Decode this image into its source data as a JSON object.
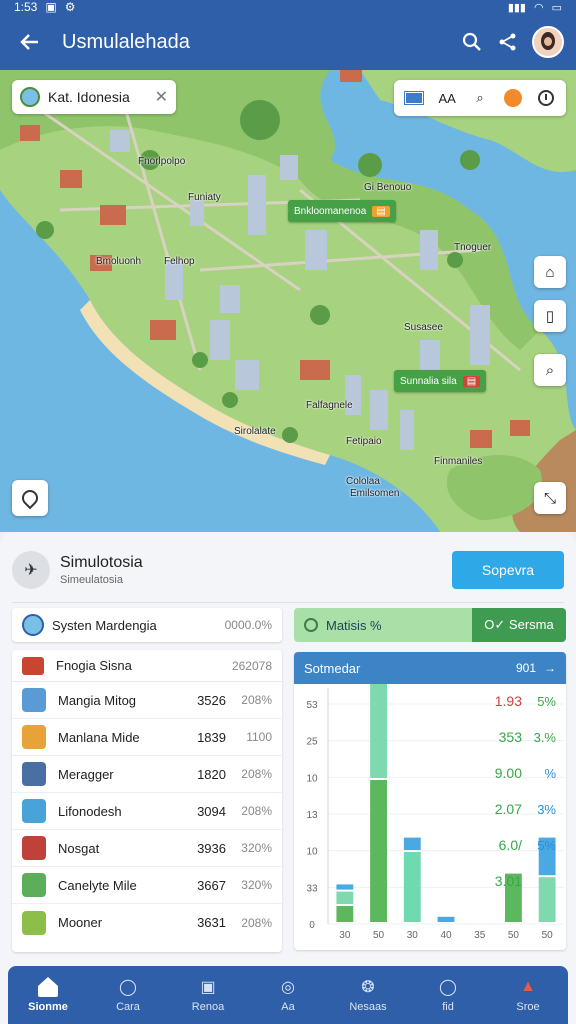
{
  "status_bar": {
    "time": "1:53"
  },
  "app_bar": {
    "title": "Usmulalehada"
  },
  "map": {
    "search_text": "Kat. Idonesia",
    "tools_text": "AA",
    "labels": [
      "Fnorlpolpo",
      "Funiaty",
      "Bmoluonh",
      "Felhop",
      "Gi Benouo",
      "Tnoguer",
      "Susasee",
      "Falfagnele",
      "Sirolalate",
      "Fetipaio",
      "Cololaa",
      "Emilsomen",
      "Finmaniles"
    ],
    "tag_green": "Bnkloomanenoa",
    "tag_green2": "Sunnalia sila"
  },
  "panel": {
    "sim_title": "Simulotosia",
    "sim_subtitle": "Simeulatosia",
    "action_button": "Sopevra",
    "system_name": "Systen Mardengia",
    "system_value": "0000.0%",
    "status_left": "Matisis %",
    "status_right": "O✓ Sersma",
    "table_header": {
      "name": "Fnogia Sisna",
      "value": "262078"
    },
    "table_rows": [
      {
        "name": "Mangia Mitog",
        "a": "3526",
        "b": "208%",
        "icon_color": "#5b9bd5"
      },
      {
        "name": "Manlana Mide",
        "a": "1839",
        "b": "1100",
        "icon_color": "#e8a23a"
      },
      {
        "name": "Meragger",
        "a": "1820",
        "b": "208%",
        "icon_color": "#4a6fa5"
      },
      {
        "name": "Lifonodesh",
        "a": "3094",
        "b": "208%",
        "icon_color": "#4aa3d8"
      },
      {
        "name": "Nosgat",
        "a": "3936",
        "b": "320%",
        "icon_color": "#c0403a"
      },
      {
        "name": "Canelyte Mile",
        "a": "3667",
        "b": "320%",
        "icon_color": "#5cae58"
      },
      {
        "name": "Mooner",
        "a": "3631",
        "b": "208%",
        "icon_color": "#8bbf4a"
      }
    ],
    "chart_header": {
      "title": "Sotmedar",
      "right": "901",
      "arrow": "→"
    }
  },
  "chart_data": {
    "type": "bar",
    "title": "Sotmedar",
    "y_ticks": [
      "53",
      "25",
      "10",
      "13",
      "10",
      "33",
      "0"
    ],
    "x_ticks": [
      "30",
      "50",
      "30",
      "40",
      "35",
      "50",
      "50"
    ],
    "series": [
      {
        "values": [
          5,
          40,
          0,
          0,
          0,
          14,
          0
        ],
        "color": "#5cb85c"
      },
      {
        "values": [
          4,
          27,
          0,
          0,
          0,
          0,
          13
        ],
        "color": "#7fd9ae"
      },
      {
        "values": [
          0,
          0,
          20,
          0,
          0,
          0,
          0
        ],
        "color": "#6fd9b0"
      },
      {
        "values": [
          2,
          10,
          4,
          2,
          0,
          0,
          0
        ],
        "color": "#4aa9e2"
      },
      {
        "values": [
          0,
          15,
          0,
          0,
          0,
          0,
          11
        ],
        "color": "#4aa9e2"
      }
    ],
    "right_values": [
      {
        "a": "1.93",
        "b": "5%",
        "a_color": "#d04040",
        "b_color": "#3aa64a"
      },
      {
        "a": "353",
        "b": "3.%",
        "a_color": "#3aa64a",
        "b_color": "#3aa64a"
      },
      {
        "a": "9.00",
        "b": "%",
        "a_color": "#3aa64a",
        "b_color": "#2b8fd6"
      },
      {
        "a": "2.07",
        "b": "3%",
        "a_color": "#3aa64a",
        "b_color": "#2b8fd6"
      },
      {
        "a": "6.0/",
        "b": "5%",
        "a_color": "#3aa64a",
        "b_color": "#2b8fd6"
      },
      {
        "a": "3.01",
        "b": "",
        "a_color": "#3aa64a",
        "b_color": "#2b8fd6"
      }
    ]
  },
  "bottom_nav": [
    {
      "label": "Sionme",
      "icon": "home-icon",
      "active": true
    },
    {
      "label": "Cara",
      "icon": "search-icon",
      "active": false
    },
    {
      "label": "Renoa",
      "icon": "chart-icon",
      "active": false
    },
    {
      "label": "Aa",
      "icon": "compass-icon",
      "active": false
    },
    {
      "label": "Nesaas",
      "icon": "people-icon",
      "active": false
    },
    {
      "label": "fid",
      "icon": "user-icon",
      "active": false
    },
    {
      "label": "Sroe",
      "icon": "settings-icon",
      "active": false
    }
  ]
}
